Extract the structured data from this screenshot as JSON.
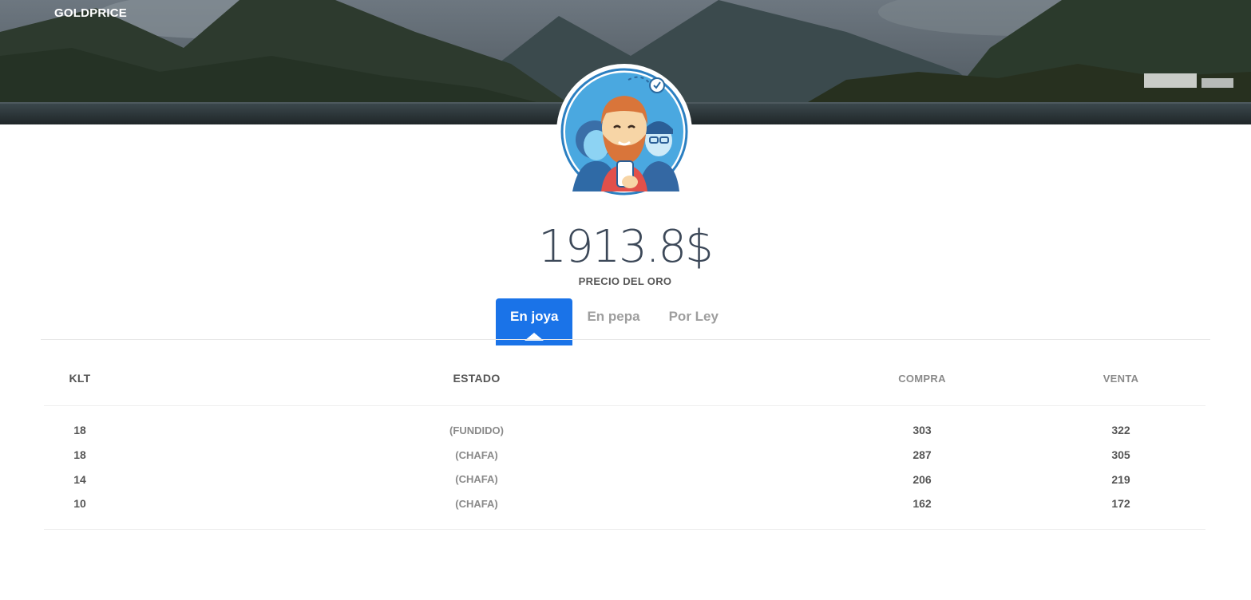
{
  "brand": {
    "title": "GOLDPRICE"
  },
  "avatar": {
    "icon": "team-avatar-illustration"
  },
  "price": {
    "value": "1913.8$",
    "label": "PRECIO DEL ORO"
  },
  "tabs": [
    {
      "label": "En joya",
      "active": true
    },
    {
      "label": "En pepa",
      "active": false
    },
    {
      "label": "Por Ley",
      "active": false
    }
  ],
  "table": {
    "headers": {
      "klt": "KLT",
      "estado": "ESTADO",
      "compra": "COMPRA",
      "venta": "VENTA"
    },
    "rows": [
      {
        "klt": "18",
        "estado": "(FUNDIDO)",
        "compra": "303",
        "venta": "322"
      },
      {
        "klt": "18",
        "estado": "(CHAFA)",
        "compra": "287",
        "venta": "305"
      },
      {
        "klt": "14",
        "estado": "(CHAFA)",
        "compra": "206",
        "venta": "219"
      },
      {
        "klt": "10",
        "estado": "(CHAFA)",
        "compra": "162",
        "venta": "172"
      }
    ]
  },
  "colors": {
    "accent": "#1a73e8",
    "text": "#3c4858",
    "muted": "#8a8a8a"
  }
}
